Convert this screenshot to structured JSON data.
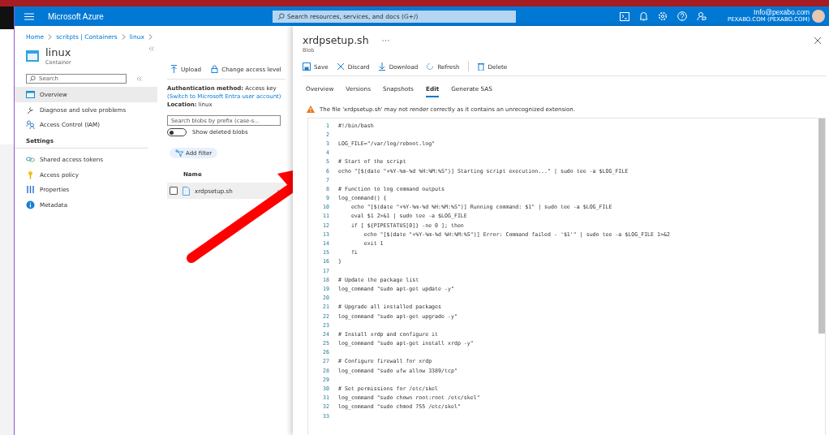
{
  "header": {
    "brand": "Microsoft Azure",
    "search": {
      "placeholder": "Search resources, services, and docs (G+/)"
    },
    "account": {
      "email": "Info@pexabo.com",
      "tenant": "PEXABO.COM (PEXABO.COM)"
    }
  },
  "breadcrumb": [
    "Home",
    "scritpts | Containers",
    "linux"
  ],
  "container": {
    "title": "linux",
    "subtitle": "Container",
    "search": {
      "placeholder": "Search"
    },
    "nav": [
      {
        "label": "Overview",
        "selected": true
      },
      {
        "label": "Diagnose and solve problems",
        "selected": false
      },
      {
        "label": "Access Control (IAM)",
        "selected": false
      }
    ],
    "settings_heading": "Settings",
    "settings": [
      {
        "label": "Shared access tokens",
        "selected": false
      },
      {
        "label": "Access policy",
        "selected": false
      },
      {
        "label": "Properties",
        "selected": false
      },
      {
        "label": "Metadata",
        "selected": false
      }
    ]
  },
  "blobs": {
    "toolbar": [
      "Upload",
      "Change access level"
    ],
    "auth_label": "Authentication method:",
    "auth_value": "Access key",
    "auth_link": "(Switch to Microsoft Entra user account)",
    "location_label": "Location:",
    "location_value": "linux",
    "filter": {
      "placeholder": "Search blobs by prefix (case-s..."
    },
    "show_deleted": {
      "label": "Show deleted blobs",
      "on": false
    },
    "add_filter": "Add filter",
    "column": "Name",
    "rows": [
      {
        "name": "xrdpsetup.sh",
        "checked": false
      }
    ]
  },
  "blob": {
    "title": "xrdpsetup.sh",
    "subtitle": "Blob",
    "toolbar": [
      "Save",
      "Discard",
      "Download",
      "Refresh",
      "Delete"
    ],
    "tabs": [
      {
        "label": "Overview",
        "selected": false
      },
      {
        "label": "Versions",
        "selected": false
      },
      {
        "label": "Snapshots",
        "selected": false
      },
      {
        "label": "Edit",
        "selected": true
      },
      {
        "label": "Generate SAS",
        "selected": false
      }
    ],
    "warning": "The file 'xrdpsetup.sh' may not render correctly as it contains an unrecognized extension.",
    "code": [
      {
        "number": "1",
        "text": "#!/bin/bash"
      },
      {
        "number": "2"
      },
      {
        "number": "3",
        "text": "LOG_FILE=\"/var/log/reboot.log\""
      },
      {
        "number": "4"
      },
      {
        "number": "5",
        "text": "# Start of the script"
      },
      {
        "number": "6",
        "text": "echo \"[$(date \"+%Y-%m-%d %H:%M:%S\")] Starting script execution...\" | sudo tee -a $LOG_FILE"
      },
      {
        "number": "7"
      },
      {
        "number": "8",
        "text": "# Function to log command outputs"
      },
      {
        "number": "9",
        "text": "log_command() {"
      },
      {
        "number": "10",
        "text": "    echo \"[$(date \"+%Y-%m-%d %H:%M:%S\")] Running command: $1\" | sudo tee -a $LOG_FILE"
      },
      {
        "number": "11",
        "text": "    eval $1 2>&1 | sudo tee -a $LOG_FILE"
      },
      {
        "number": "12",
        "text": "    if [ ${PIPESTATUS[0]} -ne 0 ]; then"
      },
      {
        "number": "13",
        "text": "        echo \"[$(date \"+%Y-%m-%d %H:%M:%S\")] Error: Command failed - '$1'\" | sudo tee -a $LOG_FILE 1>&2"
      },
      {
        "number": "14",
        "text": "        exit 1"
      },
      {
        "number": "15",
        "text": "    fi"
      },
      {
        "number": "16",
        "text": "}"
      },
      {
        "number": "17"
      },
      {
        "number": "18",
        "text": "# Update the package list"
      },
      {
        "number": "19",
        "text": "log_command \"sudo apt-get update -y\""
      },
      {
        "number": "20"
      },
      {
        "number": "21",
        "text": "# Upgrade all installed packages"
      },
      {
        "number": "22",
        "text": "log_command \"sudo apt-get upgrade -y\""
      },
      {
        "number": "23"
      },
      {
        "number": "24",
        "text": "# Install xrdp and configure it"
      },
      {
        "number": "25",
        "text": "log_command \"sudo apt-get install xrdp -y\""
      },
      {
        "number": "26"
      },
      {
        "number": "27",
        "text": "# Configure firewall for xrdp"
      },
      {
        "number": "28",
        "text": "log_command \"sudo ufw allow 3389/tcp\""
      },
      {
        "number": "29"
      },
      {
        "number": "30",
        "text": "# Set permissions for /etc/skel"
      },
      {
        "number": "31",
        "text": "log_command \"sudo chown root:root /etc/skel\""
      },
      {
        "number": "32",
        "text": "log_command \"sudo chmod 755 /etc/skel\""
      },
      {
        "number": "33"
      }
    ]
  }
}
